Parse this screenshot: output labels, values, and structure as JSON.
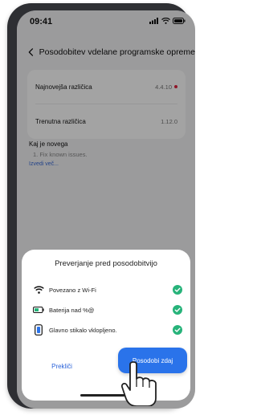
{
  "status_bar": {
    "time": "09:41"
  },
  "header": {
    "title": "Posodobitev vdelane programske opreme"
  },
  "versions": {
    "latest_label": "Najnovejša različica",
    "latest_value": "4.4.10",
    "current_label": "Trenutna različica",
    "current_value": "1.12.0"
  },
  "whats_new": {
    "title": "Kaj je novega",
    "items": [
      "1. Fix known issues."
    ],
    "more_link": "Izvedi več..."
  },
  "dialog": {
    "title": "Preverjanje pred posodobitvijo",
    "checks": [
      {
        "label": "Povezano z Wi-Fi",
        "icon": "wifi-icon"
      },
      {
        "label": "Baterija nad %@",
        "icon": "battery-icon"
      },
      {
        "label": "Glavno stikalo vklopljeno.",
        "icon": "switch-icon"
      }
    ],
    "cancel_label": "Prekliči",
    "update_label": "Posodobi zdaj"
  },
  "colors": {
    "accent": "#2a73ea",
    "check_green": "#27b37a",
    "alert_red": "#e0233f"
  }
}
